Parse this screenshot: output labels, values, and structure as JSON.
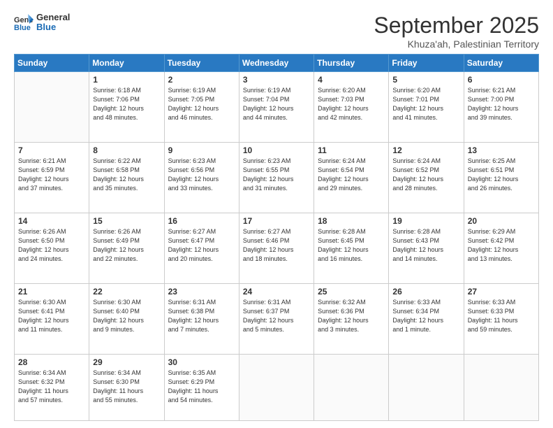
{
  "header": {
    "logo_line1": "General",
    "logo_line2": "Blue",
    "month": "September 2025",
    "location": "Khuza'ah, Palestinian Territory"
  },
  "days_of_week": [
    "Sunday",
    "Monday",
    "Tuesday",
    "Wednesday",
    "Thursday",
    "Friday",
    "Saturday"
  ],
  "weeks": [
    [
      {
        "day": "",
        "info": ""
      },
      {
        "day": "1",
        "info": "Sunrise: 6:18 AM\nSunset: 7:06 PM\nDaylight: 12 hours\nand 48 minutes."
      },
      {
        "day": "2",
        "info": "Sunrise: 6:19 AM\nSunset: 7:05 PM\nDaylight: 12 hours\nand 46 minutes."
      },
      {
        "day": "3",
        "info": "Sunrise: 6:19 AM\nSunset: 7:04 PM\nDaylight: 12 hours\nand 44 minutes."
      },
      {
        "day": "4",
        "info": "Sunrise: 6:20 AM\nSunset: 7:03 PM\nDaylight: 12 hours\nand 42 minutes."
      },
      {
        "day": "5",
        "info": "Sunrise: 6:20 AM\nSunset: 7:01 PM\nDaylight: 12 hours\nand 41 minutes."
      },
      {
        "day": "6",
        "info": "Sunrise: 6:21 AM\nSunset: 7:00 PM\nDaylight: 12 hours\nand 39 minutes."
      }
    ],
    [
      {
        "day": "7",
        "info": "Sunrise: 6:21 AM\nSunset: 6:59 PM\nDaylight: 12 hours\nand 37 minutes."
      },
      {
        "day": "8",
        "info": "Sunrise: 6:22 AM\nSunset: 6:58 PM\nDaylight: 12 hours\nand 35 minutes."
      },
      {
        "day": "9",
        "info": "Sunrise: 6:23 AM\nSunset: 6:56 PM\nDaylight: 12 hours\nand 33 minutes."
      },
      {
        "day": "10",
        "info": "Sunrise: 6:23 AM\nSunset: 6:55 PM\nDaylight: 12 hours\nand 31 minutes."
      },
      {
        "day": "11",
        "info": "Sunrise: 6:24 AM\nSunset: 6:54 PM\nDaylight: 12 hours\nand 29 minutes."
      },
      {
        "day": "12",
        "info": "Sunrise: 6:24 AM\nSunset: 6:52 PM\nDaylight: 12 hours\nand 28 minutes."
      },
      {
        "day": "13",
        "info": "Sunrise: 6:25 AM\nSunset: 6:51 PM\nDaylight: 12 hours\nand 26 minutes."
      }
    ],
    [
      {
        "day": "14",
        "info": "Sunrise: 6:26 AM\nSunset: 6:50 PM\nDaylight: 12 hours\nand 24 minutes."
      },
      {
        "day": "15",
        "info": "Sunrise: 6:26 AM\nSunset: 6:49 PM\nDaylight: 12 hours\nand 22 minutes."
      },
      {
        "day": "16",
        "info": "Sunrise: 6:27 AM\nSunset: 6:47 PM\nDaylight: 12 hours\nand 20 minutes."
      },
      {
        "day": "17",
        "info": "Sunrise: 6:27 AM\nSunset: 6:46 PM\nDaylight: 12 hours\nand 18 minutes."
      },
      {
        "day": "18",
        "info": "Sunrise: 6:28 AM\nSunset: 6:45 PM\nDaylight: 12 hours\nand 16 minutes."
      },
      {
        "day": "19",
        "info": "Sunrise: 6:28 AM\nSunset: 6:43 PM\nDaylight: 12 hours\nand 14 minutes."
      },
      {
        "day": "20",
        "info": "Sunrise: 6:29 AM\nSunset: 6:42 PM\nDaylight: 12 hours\nand 13 minutes."
      }
    ],
    [
      {
        "day": "21",
        "info": "Sunrise: 6:30 AM\nSunset: 6:41 PM\nDaylight: 12 hours\nand 11 minutes."
      },
      {
        "day": "22",
        "info": "Sunrise: 6:30 AM\nSunset: 6:40 PM\nDaylight: 12 hours\nand 9 minutes."
      },
      {
        "day": "23",
        "info": "Sunrise: 6:31 AM\nSunset: 6:38 PM\nDaylight: 12 hours\nand 7 minutes."
      },
      {
        "day": "24",
        "info": "Sunrise: 6:31 AM\nSunset: 6:37 PM\nDaylight: 12 hours\nand 5 minutes."
      },
      {
        "day": "25",
        "info": "Sunrise: 6:32 AM\nSunset: 6:36 PM\nDaylight: 12 hours\nand 3 minutes."
      },
      {
        "day": "26",
        "info": "Sunrise: 6:33 AM\nSunset: 6:34 PM\nDaylight: 12 hours\nand 1 minute."
      },
      {
        "day": "27",
        "info": "Sunrise: 6:33 AM\nSunset: 6:33 PM\nDaylight: 11 hours\nand 59 minutes."
      }
    ],
    [
      {
        "day": "28",
        "info": "Sunrise: 6:34 AM\nSunset: 6:32 PM\nDaylight: 11 hours\nand 57 minutes."
      },
      {
        "day": "29",
        "info": "Sunrise: 6:34 AM\nSunset: 6:30 PM\nDaylight: 11 hours\nand 55 minutes."
      },
      {
        "day": "30",
        "info": "Sunrise: 6:35 AM\nSunset: 6:29 PM\nDaylight: 11 hours\nand 54 minutes."
      },
      {
        "day": "",
        "info": ""
      },
      {
        "day": "",
        "info": ""
      },
      {
        "day": "",
        "info": ""
      },
      {
        "day": "",
        "info": ""
      }
    ]
  ]
}
